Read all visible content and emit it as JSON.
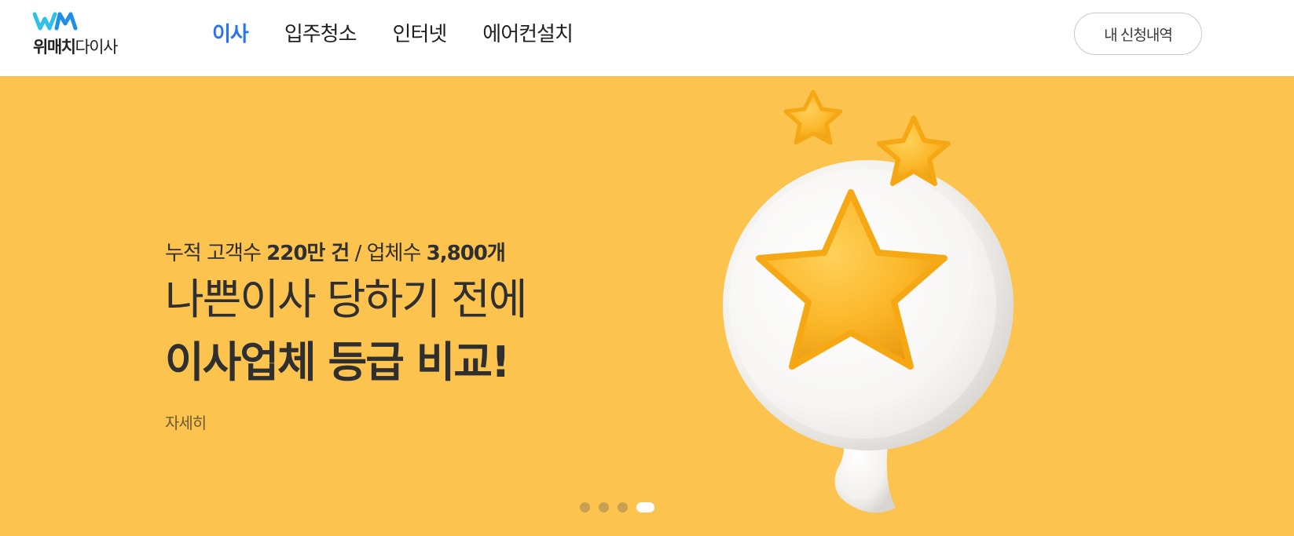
{
  "brand": {
    "name_bold": "위매치",
    "name_light": "다이사",
    "mark_color_left": "#2ec0e8",
    "mark_color_right": "#1f8fe6"
  },
  "nav": {
    "items": [
      {
        "label": "이사",
        "active": true
      },
      {
        "label": "입주청소",
        "active": false
      },
      {
        "label": "인터넷",
        "active": false
      },
      {
        "label": "에어컨설치",
        "active": false
      }
    ],
    "active_color": "#2a73f0"
  },
  "header": {
    "my_applications_label": "내 신청내역"
  },
  "hero": {
    "background": "#fdc34f",
    "stat_prefix": "누적 고객수 ",
    "stat_customers": "220만 건",
    "stat_separator": " / 업체수 ",
    "stat_companies": "3,800개",
    "headline_line1": "나쁜이사 당하기 전에",
    "headline_line2": "이사업체 등급 비교!",
    "more_link": "자세히",
    "illustration_icon": "speech-bubble-stars-icon"
  },
  "carousel": {
    "total_slides": 4,
    "active_index": 3
  }
}
